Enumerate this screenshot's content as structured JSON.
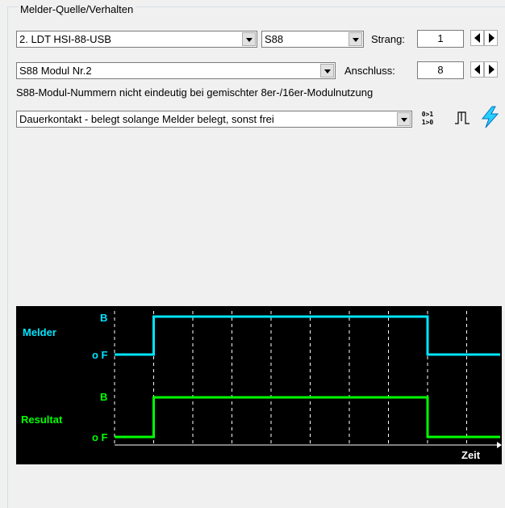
{
  "group_title": "Melder-Quelle/Verhalten",
  "device_combo": "2. LDT HSI-88-USB",
  "bus_combo": "S88",
  "strang_label": "Strang:",
  "strang_value": "1",
  "module_combo": "S88 Modul Nr.2",
  "anschluss_label": "Anschluss:",
  "anschluss_value": "8",
  "warning_text": "S88-Modul-Nummern nicht eindeutig bei gemischter 8er-/16er-Modulnutzung",
  "behavior_combo": "Dauerkontakt - belegt solange Melder belegt, sonst frei",
  "icons": {
    "invert": "invert-logic-icon",
    "pulse": "pulse-signal-icon",
    "lightning": "lightning-icon"
  },
  "invert_icon_text": {
    "top": "0>1",
    "bottom": "1>0"
  },
  "timing_diagram": {
    "melder_label": "Melder",
    "resultat_label": "Resultat",
    "high_label": "B",
    "low_label": "o F",
    "time_label": "Zeit",
    "melder_color": "#00e5ff",
    "resultat_color": "#00ff00",
    "melder_high_interval_units": [
      1,
      8
    ],
    "resultat_high_interval_units": [
      1,
      8
    ]
  }
}
